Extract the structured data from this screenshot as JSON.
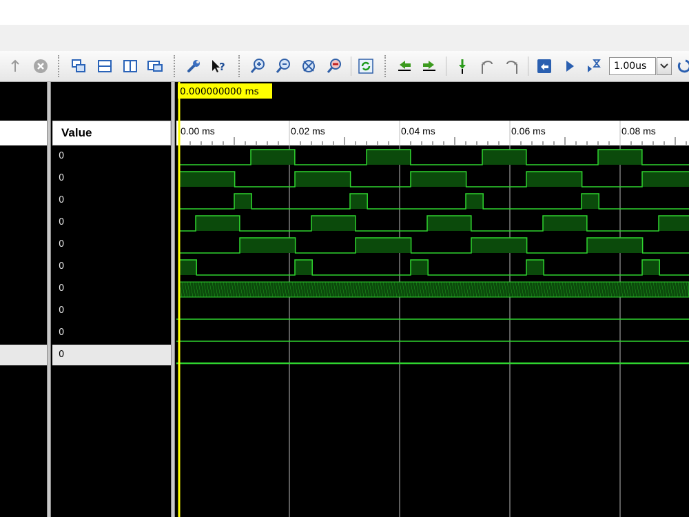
{
  "toolbar": {
    "time_input_value": "1.00us",
    "icons": [
      "up-arrow-icon",
      "cancel-icon",
      "cascade-windows-icon",
      "tile-horizontal-icon",
      "tile-vertical-icon",
      "float-window-icon",
      "wrench-icon",
      "context-help-icon",
      "zoom-in-icon",
      "zoom-out-icon",
      "zoom-fit-icon",
      "zoom-to-cursor-icon",
      "refresh-icon",
      "go-to-previous-icon",
      "go-to-next-icon",
      "add-marker-icon",
      "previous-marker-icon",
      "next-marker-icon",
      "restart-icon",
      "run-all-icon",
      "run-for-time-icon"
    ]
  },
  "columns": {
    "value_header": "Value"
  },
  "signals": [
    {
      "value": "0",
      "wave": "clock",
      "period_ms": 0.021,
      "phase_ms": 0.013,
      "duty": 0.38
    },
    {
      "value": "0",
      "wave": "clock",
      "period_ms": 0.021,
      "phase_ms": 0.021,
      "duty": 0.48
    },
    {
      "value": "0",
      "wave": "clock",
      "period_ms": 0.021,
      "phase_ms": 0.01,
      "duty": 0.15
    },
    {
      "value": "0",
      "wave": "clock",
      "period_ms": 0.021,
      "phase_ms": 0.003,
      "duty": 0.38
    },
    {
      "value": "0",
      "wave": "clock",
      "period_ms": 0.021,
      "phase_ms": 0.011,
      "duty": 0.48
    },
    {
      "value": "0",
      "wave": "clock",
      "period_ms": 0.021,
      "phase_ms": 0.021,
      "duty": 0.15
    },
    {
      "value": "0",
      "wave": "bus"
    },
    {
      "value": "0",
      "wave": "low"
    },
    {
      "value": "0",
      "wave": "low"
    },
    {
      "value": "0",
      "wave": "low",
      "selected": true
    }
  ],
  "timeline": {
    "cursor_label": "0.000000000 ms",
    "cursor_ms": 0,
    "tick_labels": [
      "0.00 ms",
      "0.02 ms",
      "0.04 ms",
      "0.06 ms",
      "0.08 ms"
    ],
    "tick_values_ms": [
      0,
      0.02,
      0.04,
      0.06,
      0.08
    ],
    "end_ms": 0.093
  },
  "colors": {
    "wave_line": "#2fd42f",
    "wave_fill": "#0b4a0b",
    "cursor": "#ffff00",
    "cursor_label_bg": "#ffff00",
    "grid": "#bdbdbd",
    "background": "#000000"
  }
}
